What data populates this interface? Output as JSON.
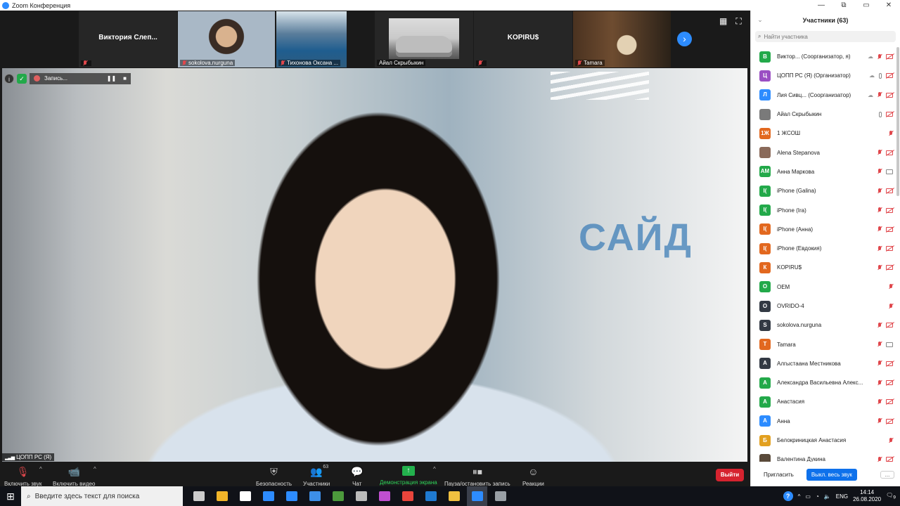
{
  "window": {
    "title": "Zoom Конференция",
    "controls": [
      "—",
      "⧉",
      "▭",
      "✕"
    ]
  },
  "thumbnails": [
    {
      "name": "Виктория  Слеп...",
      "label": "",
      "muted": true,
      "type": "name"
    },
    {
      "name": "",
      "label": "sokolova.nurguna",
      "muted": true,
      "type": "face"
    },
    {
      "name": "",
      "label": "Тихонова Оксана ...",
      "muted": true,
      "type": "forest"
    },
    {
      "name": "",
      "label": "Айал Скрыбыкин",
      "muted": false,
      "type": "car"
    },
    {
      "name": "KOPIRU$",
      "label": "",
      "muted": true,
      "type": "name"
    },
    {
      "name": "",
      "label": "Tamara",
      "muted": true,
      "type": "room"
    }
  ],
  "main_video": {
    "speaker": "ЦОПП РС (Я)",
    "background_sign": "САЙД"
  },
  "recording": {
    "label": "Запись..."
  },
  "toolbar": {
    "mute": "Включить звук",
    "video": "Включить видео",
    "security": "Безопасность",
    "participants": "Участники",
    "participants_count": "63",
    "chat": "Чат",
    "share": "Демонстрация экрана",
    "record": "Пауза/остановить запись",
    "reactions": "Реакции",
    "leave": "Выйти"
  },
  "panel": {
    "title": "Участники (63)",
    "search_placeholder": "Найти участника",
    "invite": "Пригласить",
    "mute_all": "Выкл. весь звук",
    "more": "..."
  },
  "participants": [
    {
      "initial": "В",
      "color": "#23a94a",
      "name": "Виктор...  (Соорганизатор, я)",
      "cloud": true,
      "mic": "off",
      "video": "off"
    },
    {
      "initial": "Ц",
      "color": "#9a4fc3",
      "name": "ЦОПП РС (Я) (Организатор)",
      "cloud": true,
      "mic": "on",
      "video": "off"
    },
    {
      "initial": "Л",
      "color": "#2d8cff",
      "name": "Лия Сивц...  (Соорганизатор)",
      "cloud": true,
      "mic": "off",
      "video": "off"
    },
    {
      "initial": "",
      "color": "#7a7a7a",
      "name": "Айал Скрыбыкин",
      "cloud": false,
      "mic": "on",
      "video": "off"
    },
    {
      "initial": "1Ж",
      "color": "#e2681f",
      "name": "1 ЖСОШ",
      "cloud": false,
      "mic": "off",
      "video": "none"
    },
    {
      "initial": "",
      "color": "#8a6a5a",
      "name": "Alena Stepanova",
      "cloud": false,
      "mic": "off",
      "video": "off"
    },
    {
      "initial": "АМ",
      "color": "#23a94a",
      "name": "Анна Маркова",
      "cloud": false,
      "mic": "off",
      "video": "on"
    },
    {
      "initial": "I(",
      "color": "#23a94a",
      "name": "iPhone (Galina)",
      "cloud": false,
      "mic": "off",
      "video": "off"
    },
    {
      "initial": "I(",
      "color": "#23a94a",
      "name": "iPhone (Ira)",
      "cloud": false,
      "mic": "off",
      "video": "off"
    },
    {
      "initial": "I(",
      "color": "#e2681f",
      "name": "iPhone (Анна)",
      "cloud": false,
      "mic": "off",
      "video": "off"
    },
    {
      "initial": "I(",
      "color": "#e2681f",
      "name": "iPhone (Евдокия)",
      "cloud": false,
      "mic": "off",
      "video": "off"
    },
    {
      "initial": "К",
      "color": "#e2681f",
      "name": "KOPIRU$",
      "cloud": false,
      "mic": "off",
      "video": "off"
    },
    {
      "initial": "О",
      "color": "#23a94a",
      "name": "OEM",
      "cloud": false,
      "mic": "off",
      "video": "none"
    },
    {
      "initial": "О",
      "color": "#333a44",
      "name": "OVRIDO-4",
      "cloud": false,
      "mic": "off",
      "video": "none"
    },
    {
      "initial": "S",
      "color": "#333a44",
      "name": "sokolova.nurguna",
      "cloud": false,
      "mic": "off",
      "video": "off"
    },
    {
      "initial": "Т",
      "color": "#e2681f",
      "name": "Tamara",
      "cloud": false,
      "mic": "off",
      "video": "on"
    },
    {
      "initial": "А",
      "color": "#333a44",
      "name": "Алгыстаана Местникова",
      "cloud": false,
      "mic": "off",
      "video": "off"
    },
    {
      "initial": "А",
      "color": "#23a94a",
      "name": "Александра Васильевна Алекс...",
      "cloud": false,
      "mic": "off",
      "video": "off"
    },
    {
      "initial": "А",
      "color": "#23a94a",
      "name": "Анастасия",
      "cloud": false,
      "mic": "off",
      "video": "off"
    },
    {
      "initial": "А",
      "color": "#2d8cff",
      "name": "Анна",
      "cloud": false,
      "mic": "off",
      "video": "off"
    },
    {
      "initial": "Б",
      "color": "#e2a01f",
      "name": "Белокриницкая Анастасия",
      "cloud": false,
      "mic": "off",
      "video": "none"
    },
    {
      "initial": "",
      "color": "#5a4a3a",
      "name": "Валентина Дукина",
      "cloud": false,
      "mic": "off",
      "video": "off"
    }
  ],
  "taskbar": {
    "search_placeholder": "Введите здесь текст для поиска",
    "apps": [
      {
        "name": "task-view",
        "color": "#cccccc",
        "active": false
      },
      {
        "name": "store",
        "color": "#f0b429",
        "active": false
      },
      {
        "name": "amazon",
        "color": "#ffffff",
        "active": false
      },
      {
        "name": "bluetooth-app",
        "color": "#2d8cff",
        "active": false
      },
      {
        "name": "mail",
        "color": "#2d8cff",
        "active": false
      },
      {
        "name": "dropbox",
        "color": "#3d8fe8",
        "active": false
      },
      {
        "name": "minecraft",
        "color": "#4c9a3c",
        "active": false
      },
      {
        "name": "app-8",
        "color": "#bbbbbb",
        "active": false
      },
      {
        "name": "app-9",
        "color": "#c04fd0",
        "active": false
      },
      {
        "name": "chrome",
        "color": "#e8453c",
        "active": false
      },
      {
        "name": "edge",
        "color": "#1f7ad1",
        "active": false
      },
      {
        "name": "explorer",
        "color": "#f0c040",
        "active": false
      },
      {
        "name": "zoom",
        "color": "#2d8cff",
        "active": true
      },
      {
        "name": "app-14",
        "color": "#9aa0a6",
        "active": false
      }
    ],
    "lang": "ENG",
    "time": "14:14",
    "date": "26.08.2020",
    "notifications": "9"
  }
}
